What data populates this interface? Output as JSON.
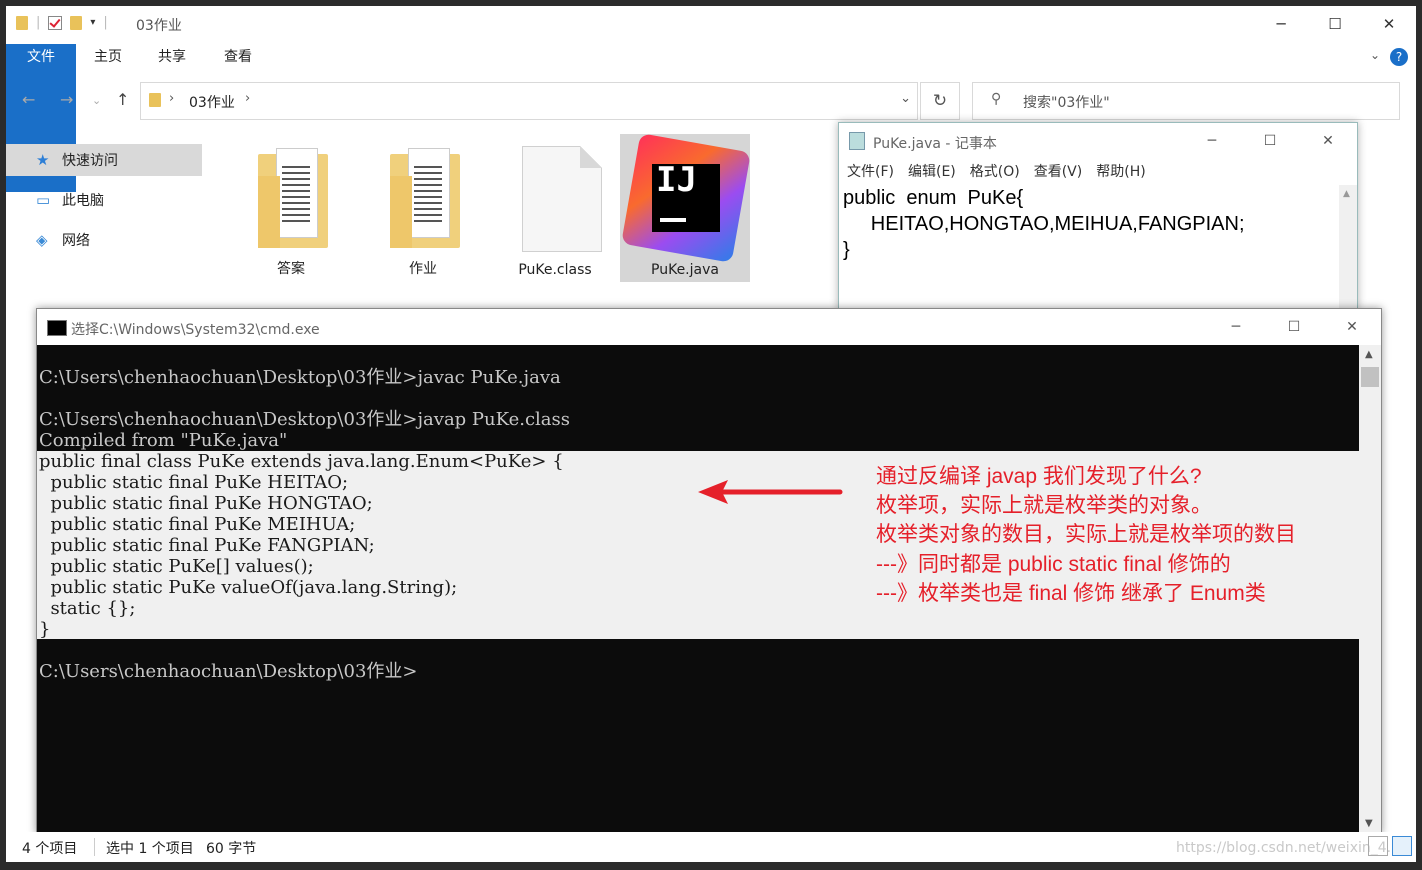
{
  "explorer": {
    "title": "03作业",
    "ribbon_tabs": [
      "文件",
      "主页",
      "共享",
      "查看"
    ],
    "address": "03作业",
    "search_placeholder": "搜索\"03作业\"",
    "sidebar": [
      "快速访问",
      "此电脑",
      "网络"
    ],
    "files": [
      {
        "name": "答案",
        "icon": "folder-icon"
      },
      {
        "name": "作业",
        "icon": "folder-icon"
      },
      {
        "name": "PuKe.class",
        "icon": "file-icon"
      },
      {
        "name": "PuKe.java",
        "icon": "intellij-icon"
      }
    ],
    "status": {
      "count": "4 个项目",
      "selected": "选中 1 个项目",
      "size": "60 字节"
    }
  },
  "notepad": {
    "title": "PuKe.java - 记事本",
    "menu": [
      "文件(F)",
      "编辑(E)",
      "格式(O)",
      "查看(V)",
      "帮助(H)"
    ],
    "lines": [
      "public  enum  PuKe{",
      "     HEITAO,HONGTAO,MEIHUA,FANGPIAN;",
      "}"
    ]
  },
  "cmd": {
    "title": "选择C:\\Windows\\System32\\cmd.exe",
    "lines_top": [
      "C:\\Users\\chenhaochuan\\Desktop\\03作业>javac PuKe.java",
      "C:\\Users\\chenhaochuan\\Desktop\\03作业>javap PuKe.class",
      "Compiled from \"PuKe.java\""
    ],
    "lines_selected": [
      "public final class PuKe extends java.lang.Enum<PuKe> {",
      "  public static final PuKe HEITAO;",
      "  public static final PuKe HONGTAO;",
      "  public static final PuKe MEIHUA;",
      "  public static final PuKe FANGPIAN;",
      "  public static PuKe[] values();",
      "  public static PuKe valueOf(java.lang.String);",
      "  static {};",
      "}"
    ],
    "prompt": "C:\\Users\\chenhaochuan\\Desktop\\03作业>"
  },
  "annotation": {
    "color": "#e5202a",
    "lines": [
      "通过反编译 javap 我们发现了什么?",
      "枚举项，实际上就是枚举类的对象。",
      "枚举类对象的数目，实际上就是枚举项的数目",
      "---》同时都是 public  static  final 修饰的",
      "---》枚举类也是 final 修饰 继承了 Enum类"
    ]
  },
  "watermark": "https://blog.csdn.net/weixin_4..."
}
